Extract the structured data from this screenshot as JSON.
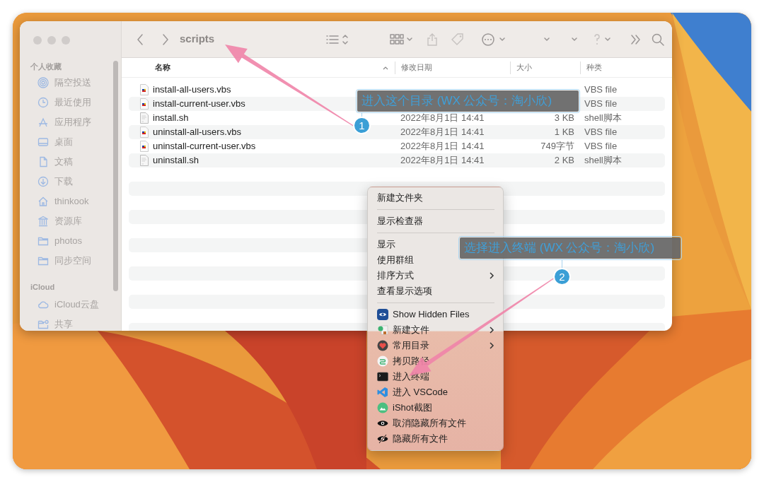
{
  "finder": {
    "title": "scripts",
    "sidebar": [
      {
        "heading": "个人收藏",
        "items": [
          "隔空投送",
          "最近使用",
          "应用程序",
          "桌面",
          "文稿",
          "下载",
          "thinkook",
          "资源库",
          "photos",
          "同步空间"
        ]
      },
      {
        "heading": "iCloud",
        "items": [
          "iCloud云盘",
          "共享"
        ]
      }
    ],
    "columns": [
      {
        "label": "名称",
        "sorted": true
      },
      {
        "label": "修改日期",
        "sorted": false
      },
      {
        "label": "大小",
        "sorted": false
      },
      {
        "label": "种类",
        "sorted": false
      }
    ],
    "files": [
      {
        "name": "install-all-users.vbs",
        "file_kind": "VBS file",
        "kind": "vbs"
      },
      {
        "name": "install-current-user.vbs",
        "file_kind": "VBS file",
        "kind": "vbs"
      },
      {
        "name": "install.sh",
        "date": "2022年8月1日 14:41",
        "size": "3 KB",
        "file_kind": "shell脚本",
        "kind": "sh"
      },
      {
        "name": "uninstall-all-users.vbs",
        "date": "2022年8月1日 14:41",
        "size": "1 KB",
        "file_kind": "VBS file",
        "kind": "vbs"
      },
      {
        "name": "uninstall-current-user.vbs",
        "date": "2022年8月1日 14:41",
        "size": "749字节",
        "file_kind": "VBS file",
        "kind": "vbs"
      },
      {
        "name": "uninstall.sh",
        "date": "2022年8月1日 14:41",
        "size": "2 KB",
        "file_kind": "shell脚本",
        "kind": "sh"
      }
    ]
  },
  "context_menu": {
    "groups": [
      [
        {
          "label": "新建文件夹",
          "submenu": false,
          "kind": "plain"
        }
      ],
      [
        {
          "label": "显示检查器",
          "submenu": false,
          "kind": "plain"
        }
      ],
      [
        {
          "label": "显示",
          "kind": "plain"
        },
        {
          "label": "使用群组",
          "submenu": false,
          "kind": "plain"
        },
        {
          "label": "排序方式",
          "submenu": true,
          "kind": "plain"
        },
        {
          "label": "查看显示选项",
          "submenu": false,
          "kind": "plain"
        }
      ],
      [
        {
          "label": "Show Hidden Files",
          "submenu": false,
          "kind": "icon"
        },
        {
          "label": "新建文件",
          "submenu": true,
          "kind": "icon"
        },
        {
          "label": "常用目录",
          "submenu": true,
          "kind": "icon"
        },
        {
          "label": "拷贝路径",
          "submenu": false,
          "kind": "icon"
        },
        {
          "label": "进入终端",
          "submenu": false,
          "kind": "icon"
        },
        {
          "label": "进入 VSCode",
          "submenu": false,
          "kind": "icon"
        },
        {
          "label": "iShot截图",
          "submenu": false,
          "kind": "icon"
        },
        {
          "label": "取消隐藏所有文件",
          "submenu": false,
          "kind": "icon"
        },
        {
          "label": "隐藏所有文件",
          "submenu": false,
          "kind": "icon"
        }
      ]
    ]
  },
  "annotations": [
    {
      "number": "1",
      "text": "进入这个目录 (WX 公众号：淘小欣)"
    },
    {
      "number": "2",
      "text": "选择进入终端 (WX 公众号：淘小欣)"
    }
  ]
}
